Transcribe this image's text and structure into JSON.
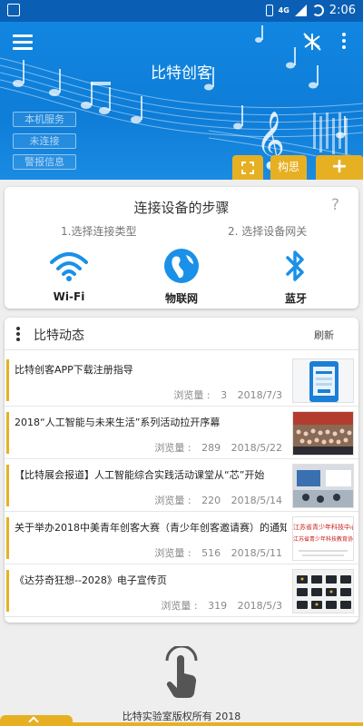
{
  "status_bar": {
    "network": "4G",
    "time": "2:06"
  },
  "header": {
    "title": "比特创客",
    "tags": [
      "本机服务",
      "未连接",
      "警报信息"
    ],
    "gouzao_label": "构思",
    "add_label": "+"
  },
  "steps": {
    "title": "连接设备的步骤",
    "help": "?",
    "step1": "1.选择连接类型",
    "step2": "2. 选择设备网关",
    "options": [
      {
        "label": "Wi-Fi",
        "icon": "wifi-icon"
      },
      {
        "label": "物联网",
        "icon": "globe-icon"
      },
      {
        "label": "蓝牙",
        "icon": "bluetooth-icon"
      }
    ]
  },
  "news": {
    "title": "比特动态",
    "refresh": "刷新",
    "views_label": "浏览量 :",
    "items": [
      {
        "title": "比特创客APP下载注册指导",
        "views": "3",
        "date": "2018/7/3"
      },
      {
        "title": "2018“人工智能与未来生活”系列活动拉开序幕",
        "views": "289",
        "date": "2018/5/22"
      },
      {
        "title": "【比特展会报道】人工智能综合实践活动课堂从“芯”开始",
        "views": "220",
        "date": "2018/5/14"
      },
      {
        "title": "关于举办2018中美青年创客大赛（青少年创客邀请赛）的通知",
        "views": "516",
        "date": "2018/5/11"
      },
      {
        "title": "《达芬奇狂想--2028》电子宣传页",
        "views": "319",
        "date": "2018/5/3"
      }
    ],
    "thumb4_text_line1": "江苏省青少年科技中心",
    "thumb4_text_line2": "江苏省青少年科技教育协会"
  },
  "footer": {
    "copyright": "比特实验室版权所有 2018"
  },
  "colors": {
    "accent": "#e6b022",
    "header_blue": "#1186e0"
  }
}
